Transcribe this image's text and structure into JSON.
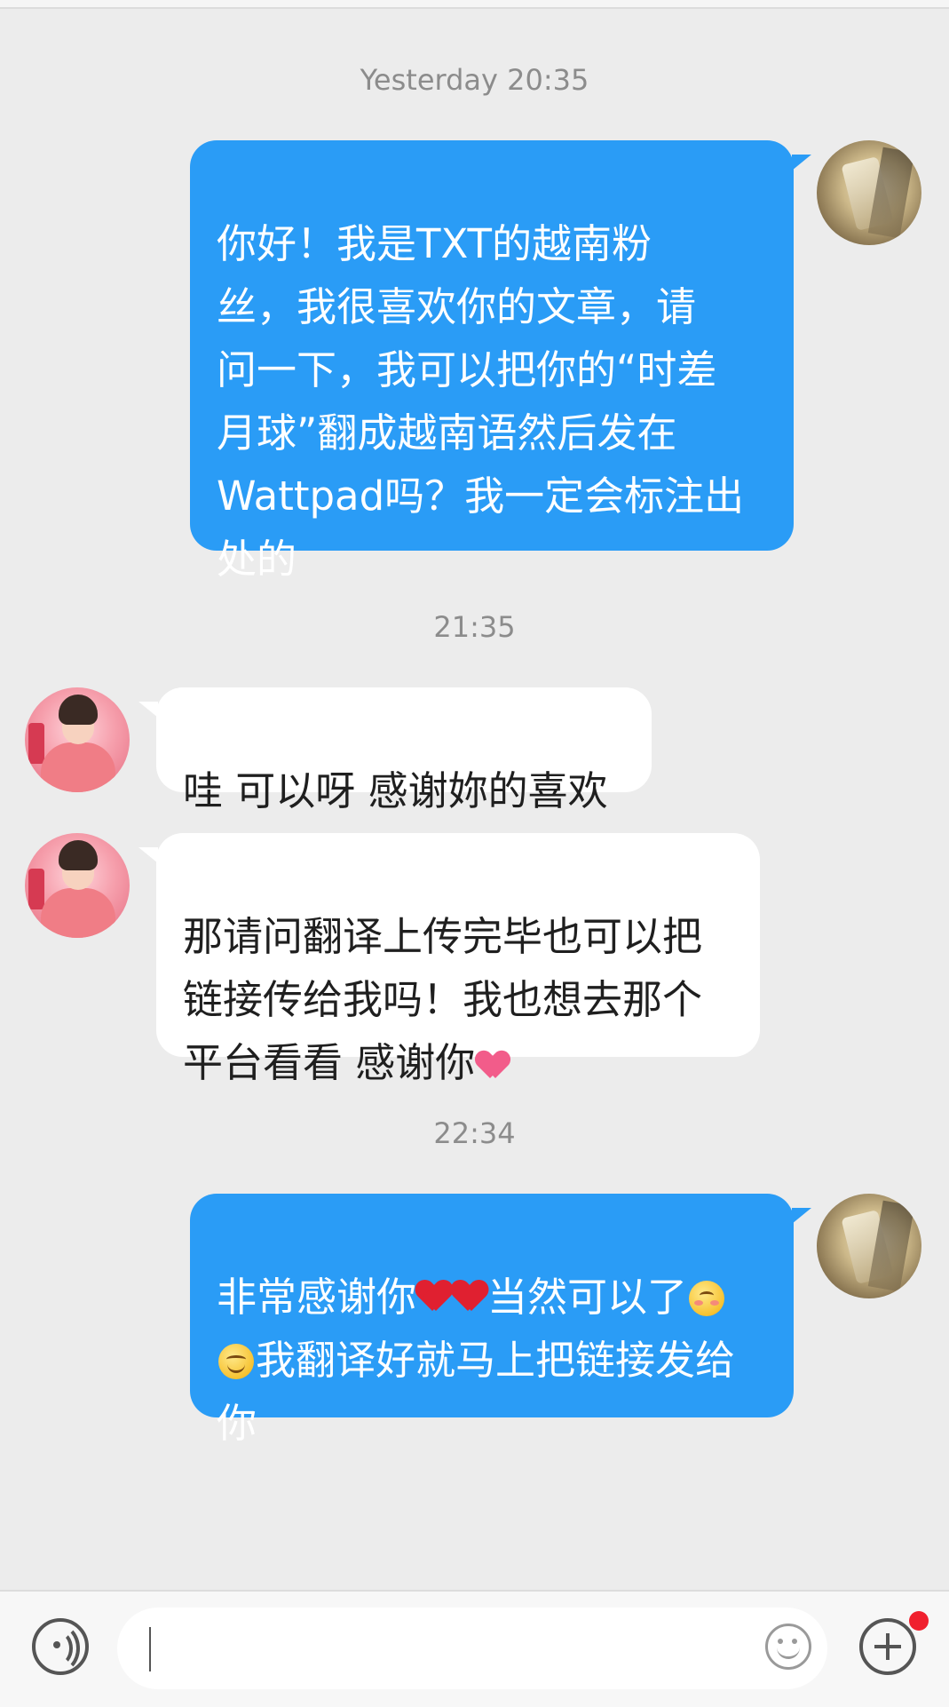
{
  "conversation": {
    "timestamps": [
      "Yesterday 20:35",
      "21:35",
      "22:34"
    ],
    "messages": [
      {
        "sender": "self",
        "text": "你好！我是TXT的越南粉\n丝，我很喜欢你的文章，请\n问一下，我可以把你的“时差\n月球”翻成越南语然后发在\nWattpad吗？我一定会标注出\n处的"
      },
      {
        "sender": "other",
        "text": "哇 可以呀 感谢妳的喜欢"
      },
      {
        "sender": "other",
        "text_parts": [
          "那请问翻译上传完毕也可以把\n链接传给我吗！我也想去那个\n平台看看 感谢你"
        ],
        "emoji": "pink-heart"
      },
      {
        "sender": "self",
        "text_parts": [
          "非常感谢你",
          "当然可以了",
          "我翻译好就马上把链接发给\n你"
        ],
        "emoji": [
          "red-heart",
          "red-heart",
          "blush-face",
          "smile-face"
        ]
      }
    ]
  },
  "colors": {
    "background": "#ececec",
    "sent_bubble": "#2a9cf6",
    "received_bubble": "#ffffff",
    "timestamp_text": "#8c8c8c",
    "notification_dot": "#f0202e"
  },
  "input_bar": {
    "placeholder": "",
    "icons": [
      "voice-icon",
      "emoji-icon",
      "plus-icon"
    ]
  }
}
